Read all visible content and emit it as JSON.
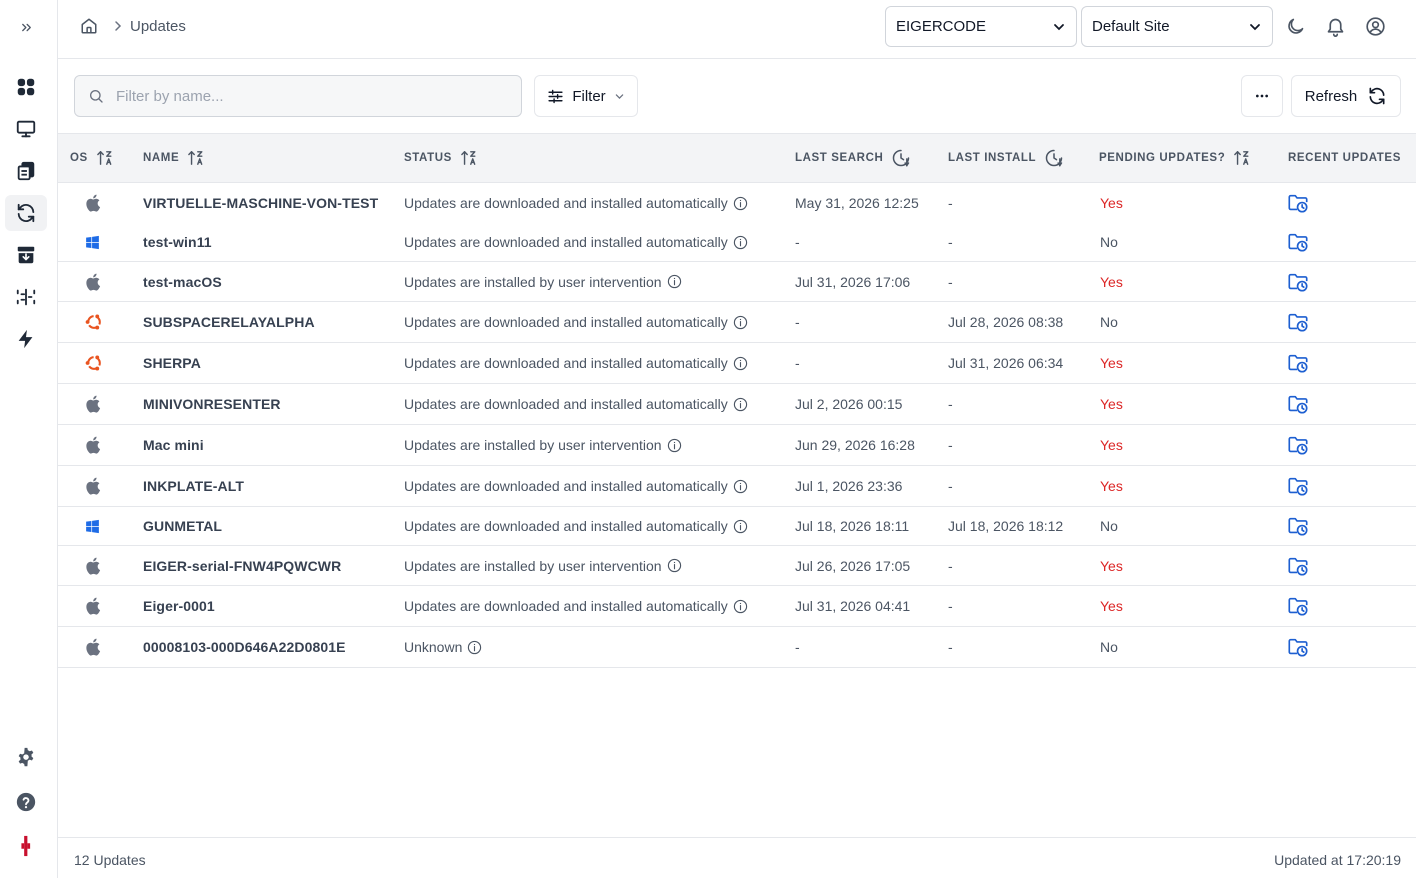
{
  "breadcrumb": {
    "current": "Updates"
  },
  "header": {
    "org_select": "EIGERCODE",
    "site_select": "Default Site"
  },
  "toolbar": {
    "search_placeholder": "Filter by name...",
    "filter_label": "Filter",
    "more_label": "···",
    "refresh_label": "Refresh"
  },
  "table": {
    "columns": {
      "os": "OS",
      "name": "NAME",
      "status": "STATUS",
      "last_search": "LAST SEARCH",
      "last_install": "LAST INSTALL",
      "pending": "PENDING UPDATES?",
      "recent": "RECENT UPDATES"
    },
    "rows": [
      {
        "os": "apple",
        "name": "VIRTUELLE-MASCHINE-VON-TEST",
        "status": "Updates are downloaded and installed automatically",
        "last_search": "May 31, 2026 12:25",
        "last_install": "-",
        "pending": "Yes"
      },
      {
        "os": "windows",
        "name": "test-win11",
        "status": "Updates are downloaded and installed automatically",
        "last_search": "-",
        "last_install": "-",
        "pending": "No"
      },
      {
        "os": "apple",
        "name": "test-macOS",
        "status": "Updates are installed by user intervention",
        "last_search": "Jul 31, 2026 17:06",
        "last_install": "-",
        "pending": "Yes"
      },
      {
        "os": "ubuntu",
        "name": "SUBSPACERELAYALPHA",
        "status": "Updates are downloaded and installed automatically",
        "last_search": "-",
        "last_install": "Jul 28, 2026 08:38",
        "pending": "No"
      },
      {
        "os": "ubuntu",
        "name": "SHERPA",
        "status": "Updates are downloaded and installed automatically",
        "last_search": "-",
        "last_install": "Jul 31, 2026 06:34",
        "pending": "Yes"
      },
      {
        "os": "apple",
        "name": "MINIVONRESENTER",
        "status": "Updates are downloaded and installed automatically",
        "last_search": "Jul 2, 2026 00:15",
        "last_install": "-",
        "pending": "Yes"
      },
      {
        "os": "apple",
        "name": "Mac mini",
        "status": "Updates are installed by user intervention",
        "last_search": "Jun 29, 2026 16:28",
        "last_install": "-",
        "pending": "Yes"
      },
      {
        "os": "apple",
        "name": "INKPLATE-ALT",
        "status": "Updates are downloaded and installed automatically",
        "last_search": "Jul 1, 2026 23:36",
        "last_install": "-",
        "pending": "Yes"
      },
      {
        "os": "windows",
        "name": "GUNMETAL",
        "status": "Updates are downloaded and installed automatically",
        "last_search": "Jul 18, 2026 18:11",
        "last_install": "Jul 18, 2026 18:12",
        "pending": "No"
      },
      {
        "os": "apple",
        "name": "EIGER-serial-FNW4PQWCWR",
        "status": "Updates are installed by user intervention",
        "last_search": "Jul 26, 2026 17:05",
        "last_install": "-",
        "pending": "Yes"
      },
      {
        "os": "apple",
        "name": "Eiger-0001",
        "status": "Updates are downloaded and installed automatically",
        "last_search": "Jul 31, 2026 04:41",
        "last_install": "-",
        "pending": "Yes"
      },
      {
        "os": "apple",
        "name": "00008103-000D646A22D0801E",
        "status": "Unknown",
        "last_search": "-",
        "last_install": "-",
        "pending": "No"
      }
    ]
  },
  "footer": {
    "count": "12 Updates",
    "updated": "Updated at 17:20:19"
  },
  "colors": {
    "accent_blue": "#1d5fd1",
    "yes_red": "#dc2626",
    "ubuntu_orange": "#e95420",
    "windows_blue": "#1e6be6"
  }
}
